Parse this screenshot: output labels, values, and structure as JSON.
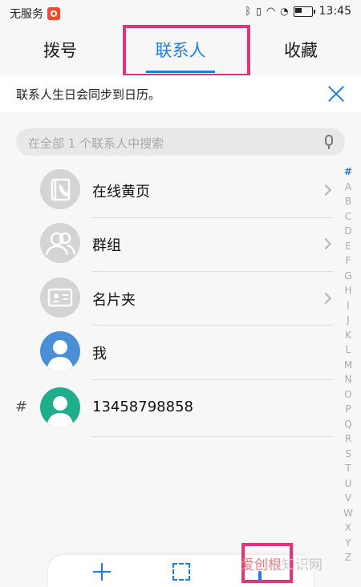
{
  "status_bar": {
    "carrier": "无服务",
    "time": "13:45"
  },
  "tabs": [
    {
      "label": "拨号"
    },
    {
      "label": "联系人"
    },
    {
      "label": "收藏"
    }
  ],
  "banner": {
    "text": "联系人生日会同步到日历。"
  },
  "search": {
    "placeholder": "在全部 1 个联系人中搜索"
  },
  "rows": [
    {
      "label": "在线黄页",
      "icon": "yellow-pages-icon"
    },
    {
      "label": "群组",
      "icon": "group-icon"
    },
    {
      "label": "名片夹",
      "icon": "business-card-icon"
    },
    {
      "label": "我",
      "icon": "avatar"
    },
    {
      "label": "13458798858",
      "icon": "avatar",
      "section": "#"
    }
  ],
  "alphabet": [
    "#",
    "A",
    "B",
    "C",
    "D",
    "E",
    "F",
    "G",
    "H",
    "I",
    "J",
    "K",
    "L",
    "M",
    "N",
    "O",
    "P",
    "Q",
    "R",
    "S",
    "T",
    "U",
    "V",
    "W",
    "X",
    "Y",
    "Z"
  ],
  "colors": {
    "accent": "#1e7fe0",
    "highlight": "#e0357a",
    "avatar_me": "#4a8fd6",
    "avatar_contact": "#1fae8b"
  },
  "watermark": {
    "part1": "爱创根",
    "part2": "知识网"
  }
}
